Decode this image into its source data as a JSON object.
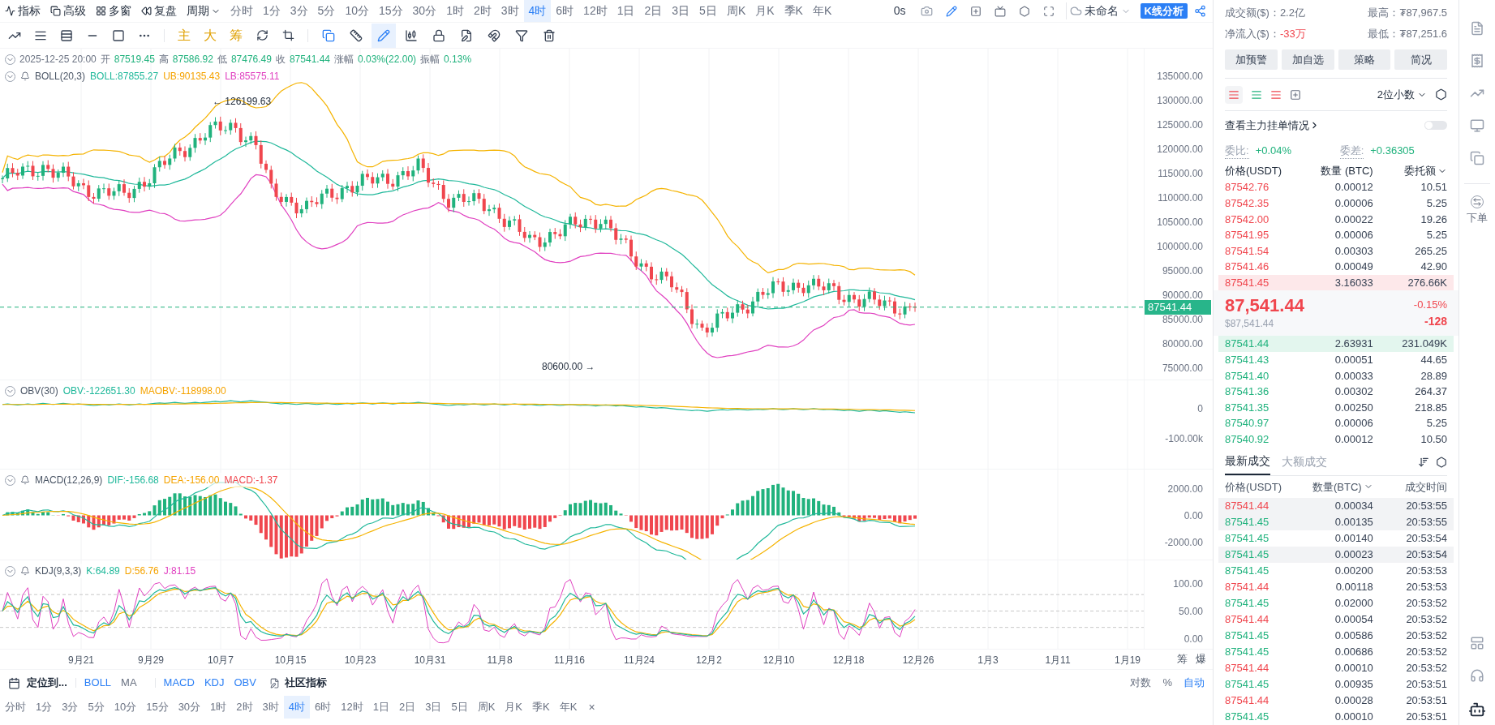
{
  "toolbar": {
    "menus": [
      {
        "kind": "indicator",
        "label": "指标"
      },
      {
        "kind": "advanced",
        "label": "高级"
      },
      {
        "kind": "multi",
        "label": "多窗"
      },
      {
        "kind": "replay",
        "label": "复盘"
      }
    ],
    "period_menu": "周期",
    "periods": [
      {
        "label": "分时",
        "selected": false
      },
      {
        "label": "1分",
        "selected": false
      },
      {
        "label": "3分",
        "selected": false
      },
      {
        "label": "5分",
        "selected": false
      },
      {
        "label": "10分",
        "selected": false
      },
      {
        "label": "15分",
        "selected": false
      },
      {
        "label": "30分",
        "selected": false
      },
      {
        "label": "1时",
        "selected": false
      },
      {
        "label": "2时",
        "selected": false
      },
      {
        "label": "3时",
        "selected": false
      },
      {
        "label": "4时",
        "selected": true
      },
      {
        "label": "6时",
        "selected": false
      },
      {
        "label": "12时",
        "selected": false
      },
      {
        "label": "1日",
        "selected": false
      },
      {
        "label": "2日",
        "selected": false
      },
      {
        "label": "3日",
        "selected": false
      },
      {
        "label": "5日",
        "selected": false
      },
      {
        "label": "周K",
        "selected": false
      },
      {
        "label": "月K",
        "selected": false
      },
      {
        "label": "季K",
        "selected": false
      },
      {
        "label": "年K",
        "selected": false
      }
    ],
    "timer": "0s",
    "layout_name": "未命名",
    "analysis_button": "K线分析"
  },
  "drawing_tools": {
    "shortcuts": [
      "主",
      "大",
      "筹"
    ]
  },
  "chart": {
    "datetime": "2025-12-25 20:00",
    "ohlc": [
      {
        "label": "开",
        "value": "87519.45"
      },
      {
        "label": "高",
        "value": "87586.92"
      },
      {
        "label": "低",
        "value": "87476.49"
      },
      {
        "label": "收",
        "value": "87541.44"
      },
      {
        "label": "涨幅",
        "value": "0.03%(22.00)"
      },
      {
        "label": "振幅",
        "value": "0.13%"
      }
    ],
    "boll": {
      "title": "BOLL(20,3)",
      "values": [
        {
          "text": "BOLL:87855.27",
          "color": "#1fb89a"
        },
        {
          "text": "UB:90135.43",
          "color": "#f5a300"
        },
        {
          "text": "LB:85575.11",
          "color": "#e040c0"
        }
      ]
    },
    "price_axis": [
      "135000.00",
      "130000.00",
      "125000.00",
      "120000.00",
      "115000.00",
      "110000.00",
      "105000.00",
      "100000.00",
      "95000.00",
      "90000.00",
      "85000.00",
      "80000.00",
      "75000.00"
    ],
    "current_price": "87541.44",
    "high_marker": "← 126199.63",
    "low_marker": "80600.00 →"
  },
  "obv": {
    "title": "OBV(30)",
    "values": [
      {
        "text": "OBV:-122651.30",
        "color": "#1fb89a"
      },
      {
        "text": "MAOBV:-118998.00",
        "color": "#f5a300"
      }
    ],
    "axis": [
      "0",
      "-100.00k"
    ]
  },
  "macd": {
    "title": "MACD(12,26,9)",
    "values": [
      {
        "text": "DIF:-156.68",
        "color": "#1fb89a"
      },
      {
        "text": "DEA:-156.00",
        "color": "#f5a300"
      },
      {
        "text": "MACD:-1.37",
        "color": "#f0464e"
      }
    ],
    "axis": [
      "2000.00",
      "0.00",
      "-2000.00"
    ]
  },
  "kdj": {
    "title": "KDJ(9,3,3)",
    "values": [
      {
        "text": "K:64.89",
        "color": "#1fb89a"
      },
      {
        "text": "D:56.76",
        "color": "#f5a300"
      },
      {
        "text": "J:81.15",
        "color": "#e040c0"
      }
    ],
    "axis": [
      "100.00",
      "50.00",
      "0.00"
    ]
  },
  "date_axis": [
    "9月21",
    "9月29",
    "10月7",
    "10月15",
    "10月23",
    "10月31",
    "11月8",
    "11月16",
    "11月24",
    "12月2",
    "12月10",
    "12月18",
    "12月26",
    "1月3",
    "1月11",
    "1月19"
  ],
  "side_labels": [
    "筹",
    "爆"
  ],
  "bottom_bar": {
    "locate": "定位到...",
    "main_indicators": [
      {
        "label": "BOLL",
        "active": true
      },
      {
        "label": "MA",
        "active": false
      }
    ],
    "sub_indicators": [
      {
        "label": "MACD",
        "active": true
      },
      {
        "label": "KDJ",
        "active": true
      },
      {
        "label": "OBV",
        "active": true
      }
    ],
    "community": "社区指标",
    "scales": [
      {
        "label": "对数",
        "selected": false
      },
      {
        "label": "%",
        "selected": false
      },
      {
        "label": "自动",
        "selected": true
      }
    ]
  },
  "period_bar": {
    "periods": [
      {
        "label": "分时",
        "selected": false
      },
      {
        "label": "1分",
        "selected": false
      },
      {
        "label": "3分",
        "selected": false
      },
      {
        "label": "5分",
        "selected": false
      },
      {
        "label": "10分",
        "selected": false
      },
      {
        "label": "15分",
        "selected": false
      },
      {
        "label": "30分",
        "selected": false
      },
      {
        "label": "1时",
        "selected": false
      },
      {
        "label": "2时",
        "selected": false
      },
      {
        "label": "3时",
        "selected": false
      },
      {
        "label": "4时",
        "selected": true
      },
      {
        "label": "6时",
        "selected": false
      },
      {
        "label": "12时",
        "selected": false
      },
      {
        "label": "1日",
        "selected": false
      },
      {
        "label": "2日",
        "selected": false
      },
      {
        "label": "3日",
        "selected": false
      },
      {
        "label": "5日",
        "selected": false
      },
      {
        "label": "周K",
        "selected": false
      },
      {
        "label": "月K",
        "selected": false
      },
      {
        "label": "季K",
        "selected": false
      },
      {
        "label": "年K",
        "selected": false
      }
    ],
    "close": "×"
  },
  "market": {
    "stats": [
      {
        "label": "成交额($)：",
        "value": "2.2亿",
        "color": "#6b7280"
      },
      {
        "label": "最高：",
        "value": "₮87,967.5",
        "color": "#6b7280"
      },
      {
        "label": "净流入($)：",
        "value": "-33万",
        "color": "#f0464e"
      },
      {
        "label": "最低：",
        "value": "₮87,251.6",
        "color": "#6b7280"
      }
    ],
    "buttons": [
      "加预警",
      "加自选",
      "策略",
      "简况"
    ]
  },
  "order_book": {
    "decimals": "2位小数",
    "main_orders": {
      "label": "查看主力挂单情况",
      "on": false
    },
    "ratio": {
      "label": "委比:",
      "value": "+0.04%"
    },
    "diff": {
      "label": "委差:",
      "value": "+0.36305"
    },
    "columns": [
      "价格(USDT)",
      "数量 (BTC)",
      "委托额"
    ],
    "asks": [
      {
        "price": "87542.76",
        "amount": "0.00012",
        "total": "10.51"
      },
      {
        "price": "87542.35",
        "amount": "0.00006",
        "total": "5.25"
      },
      {
        "price": "87542.00",
        "amount": "0.00022",
        "total": "19.26"
      },
      {
        "price": "87541.95",
        "amount": "0.00006",
        "total": "5.25"
      },
      {
        "price": "87541.54",
        "amount": "0.00303",
        "total": "265.25"
      },
      {
        "price": "87541.46",
        "amount": "0.00049",
        "total": "42.90"
      },
      {
        "price": "87541.45",
        "amount": "3.16033",
        "total": "276.66K",
        "level": 1
      }
    ],
    "last_price": "87,541.44",
    "last_price_usd": "$87,541.44",
    "change_pct": "-0.15%",
    "change": "-128",
    "bids": [
      {
        "price": "87541.44",
        "amount": "2.63931",
        "total": "231.049K",
        "level": 1
      },
      {
        "price": "87541.43",
        "amount": "0.00051",
        "total": "44.65"
      },
      {
        "price": "87541.40",
        "amount": "0.00033",
        "total": "28.89"
      },
      {
        "price": "87541.36",
        "amount": "0.00302",
        "total": "264.37"
      },
      {
        "price": "87541.35",
        "amount": "0.00250",
        "total": "218.85"
      },
      {
        "price": "87540.97",
        "amount": "0.00006",
        "total": "5.25"
      },
      {
        "price": "87540.92",
        "amount": "0.00012",
        "total": "10.50"
      }
    ]
  },
  "trades": {
    "tabs": [
      {
        "label": "最新成交",
        "selected": true
      },
      {
        "label": "大额成交",
        "selected": false
      }
    ],
    "columns": [
      "价格(USDT)",
      "数量(BTC)",
      "成交时间"
    ],
    "rows": [
      {
        "price": "87541.44",
        "color": "#f0464e",
        "amount": "0.00034",
        "time": "20:53:55",
        "highlighted": true
      },
      {
        "price": "87541.45",
        "color": "#20b27d",
        "amount": "0.00135",
        "time": "20:53:55",
        "highlighted": true
      },
      {
        "price": "87541.45",
        "color": "#20b27d",
        "amount": "0.00140",
        "time": "20:53:54",
        "highlighted": false
      },
      {
        "price": "87541.45",
        "color": "#20b27d",
        "amount": "0.00023",
        "time": "20:53:54",
        "highlighted": true
      },
      {
        "price": "87541.45",
        "color": "#20b27d",
        "amount": "0.00200",
        "time": "20:53:53",
        "highlighted": false
      },
      {
        "price": "87541.44",
        "color": "#f0464e",
        "amount": "0.00118",
        "time": "20:53:53",
        "highlighted": false
      },
      {
        "price": "87541.45",
        "color": "#20b27d",
        "amount": "0.02000",
        "time": "20:53:52",
        "highlighted": false
      },
      {
        "price": "87541.44",
        "color": "#f0464e",
        "amount": "0.00054",
        "time": "20:53:52",
        "highlighted": false
      },
      {
        "price": "87541.45",
        "color": "#20b27d",
        "amount": "0.00586",
        "time": "20:53:52",
        "highlighted": false
      },
      {
        "price": "87541.45",
        "color": "#20b27d",
        "amount": "0.00686",
        "time": "20:53:52",
        "highlighted": false
      },
      {
        "price": "87541.44",
        "color": "#f0464e",
        "amount": "0.00010",
        "time": "20:53:52",
        "highlighted": false
      },
      {
        "price": "87541.45",
        "color": "#20b27d",
        "amount": "0.00935",
        "time": "20:53:51",
        "highlighted": false
      },
      {
        "price": "87541.44",
        "color": "#f0464e",
        "amount": "0.00028",
        "time": "20:53:51",
        "highlighted": false
      },
      {
        "price": "87541.45",
        "color": "#20b27d",
        "amount": "0.00010",
        "time": "20:53:51",
        "highlighted": false
      }
    ]
  },
  "side_nav": {
    "order_label": "下单"
  }
}
